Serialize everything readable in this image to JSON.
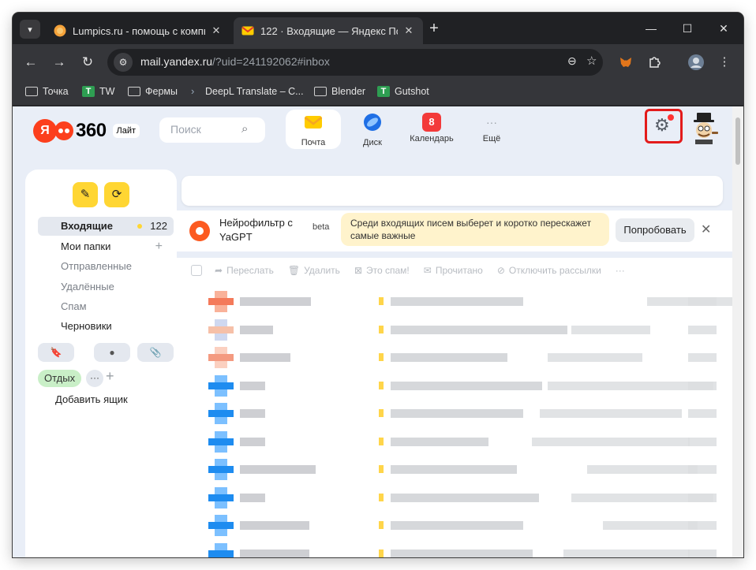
{
  "browser": {
    "tabs": [
      {
        "title": "Lumpics.ru - помощь с компь",
        "active": false
      },
      {
        "title": "122 · Входящие — Яндекс Поч",
        "active": true
      }
    ],
    "url_host": "mail.yandex.ru",
    "url_path": "/?uid=241192062#inbox",
    "bookmarks": [
      "Точка",
      "TW",
      "Фермы",
      "DeepL Translate – С...",
      "Blender",
      "Gutshot"
    ]
  },
  "header": {
    "logo_ya": "Я",
    "logo_360": "360",
    "lite_badge": "Лайт",
    "search_placeholder": "Поиск",
    "services": [
      {
        "label": "Почта",
        "selected": true,
        "icon": "mail-envelope-icon"
      },
      {
        "label": "Диск",
        "selected": false,
        "icon": "disk-icon"
      },
      {
        "label": "Календарь",
        "selected": false,
        "icon": "calendar-icon",
        "badge": "8"
      },
      {
        "label": "Ещё",
        "selected": false,
        "icon": "more-dots-icon"
      }
    ],
    "settings_icon": "gear-icon",
    "settings_highlight_color": "#e31b1b"
  },
  "sidebar": {
    "folders": [
      {
        "label": "Входящие",
        "count": "122",
        "selected": true
      },
      {
        "label": "Мои папки",
        "selected": false
      },
      {
        "label": "Отправленные",
        "selected": false
      },
      {
        "label": "Удалённые",
        "selected": false
      },
      {
        "label": "Спам",
        "selected": false
      },
      {
        "label": "Черновики",
        "selected": false
      }
    ],
    "tag": "Отдых",
    "add_mailbox": "Добавить ящик"
  },
  "promo": {
    "title": "Нейрофильтр с YaGPT",
    "badge": "beta",
    "text": "Среди входящих писем выберет и коротко перескажет самые важные",
    "button": "Попробовать"
  },
  "toolbar_actions": [
    "Переслать",
    "Удалить",
    "Это спам!",
    "Прочитано",
    "Отключить рассылки",
    "···"
  ],
  "colors": {
    "accent_yellow": "#ffd633",
    "brand_red": "#fc3f1d",
    "page_bg": "#e9eef7"
  }
}
